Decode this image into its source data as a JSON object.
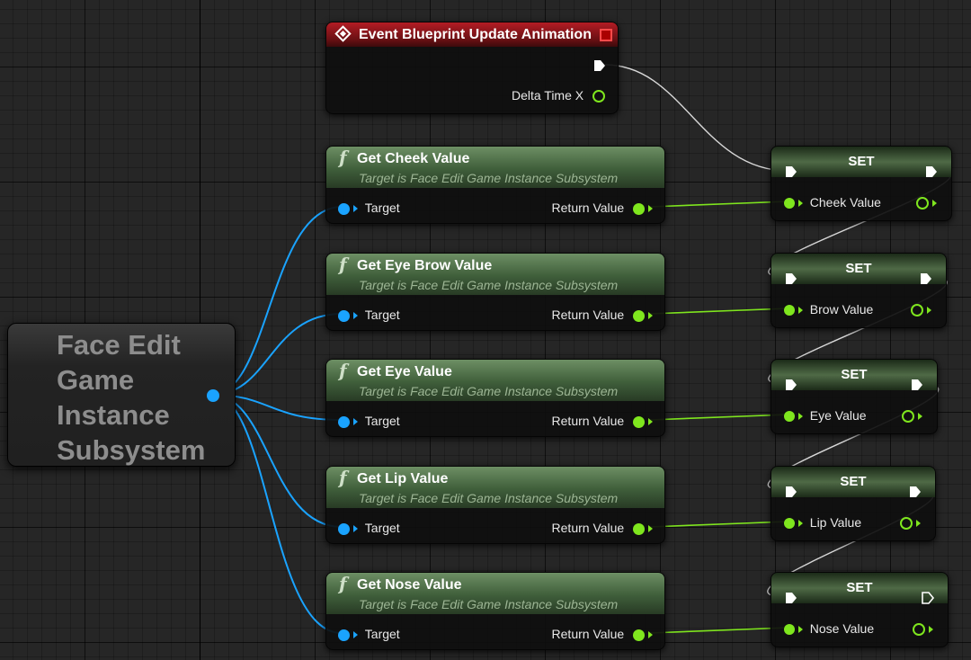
{
  "event_node": {
    "title": "Event Blueprint Update Animation",
    "delta_label": "Delta Time X"
  },
  "subsystem_node": {
    "label": "Face Edit Game Instance Subsystem"
  },
  "get_nodes": [
    {
      "title": "Get Cheek Value",
      "subtitle": "Target is Face Edit Game Instance Subsystem",
      "target_label": "Target",
      "return_label": "Return Value"
    },
    {
      "title": "Get Eye Brow Value",
      "subtitle": "Target is Face Edit Game Instance Subsystem",
      "target_label": "Target",
      "return_label": "Return Value"
    },
    {
      "title": "Get Eye Value",
      "subtitle": "Target is Face Edit Game Instance Subsystem",
      "target_label": "Target",
      "return_label": "Return Value"
    },
    {
      "title": "Get Lip Value",
      "subtitle": "Target is Face Edit Game Instance Subsystem",
      "target_label": "Target",
      "return_label": "Return Value"
    },
    {
      "title": "Get Nose Value",
      "subtitle": "Target is Face Edit Game Instance Subsystem",
      "target_label": "Target",
      "return_label": "Return Value"
    }
  ],
  "set_nodes": [
    {
      "title": "SET",
      "var_label": "Cheek Value"
    },
    {
      "title": "SET",
      "var_label": "Brow Value"
    },
    {
      "title": "SET",
      "var_label": "Eye Value"
    },
    {
      "title": "SET",
      "var_label": "Lip Value"
    },
    {
      "title": "SET",
      "var_label": "Nose Value"
    }
  ],
  "colors": {
    "object_pin": "#1aa3ff",
    "float_pin": "#7fe61e",
    "exec_wire": "#d0d0d0",
    "event_header": "#b31c24",
    "function_header": "#5a7a52"
  }
}
